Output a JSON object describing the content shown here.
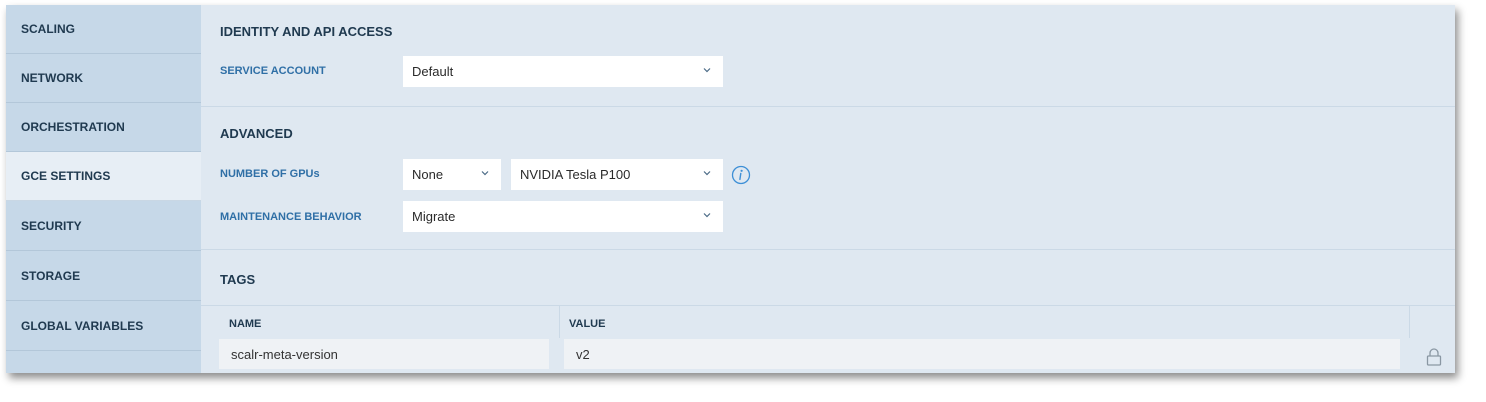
{
  "sidebar": {
    "items": [
      {
        "label": "SCALING"
      },
      {
        "label": "NETWORK"
      },
      {
        "label": "ORCHESTRATION"
      },
      {
        "label": "GCE SETTINGS",
        "active": true
      },
      {
        "label": "SECURITY"
      },
      {
        "label": "STORAGE"
      },
      {
        "label": "GLOBAL VARIABLES"
      }
    ]
  },
  "identity": {
    "title": "IDENTITY AND API ACCESS",
    "service_account_label": "SERVICE ACCOUNT",
    "service_account_value": "Default"
  },
  "advanced": {
    "title": "ADVANCED",
    "gpu_label": "NUMBER OF GPUs",
    "gpu_count_value": "None",
    "gpu_type_value": "NVIDIA Tesla P100",
    "maintenance_label": "MAINTENANCE BEHAVIOR",
    "maintenance_value": "Migrate"
  },
  "tags": {
    "title": "TAGS",
    "columns": [
      "NAME",
      "VALUE"
    ],
    "rows": [
      {
        "name": "scalr-meta-version",
        "value": "v2",
        "locked": true
      }
    ]
  },
  "colors": {
    "sidebar_bg": "#c6d8e8",
    "content_bg": "#dfe8f1",
    "label_blue": "#2f6fa6",
    "heading_dark": "#203a50"
  },
  "icons": [
    "chevron-down-icon",
    "info-icon",
    "lock-icon"
  ]
}
